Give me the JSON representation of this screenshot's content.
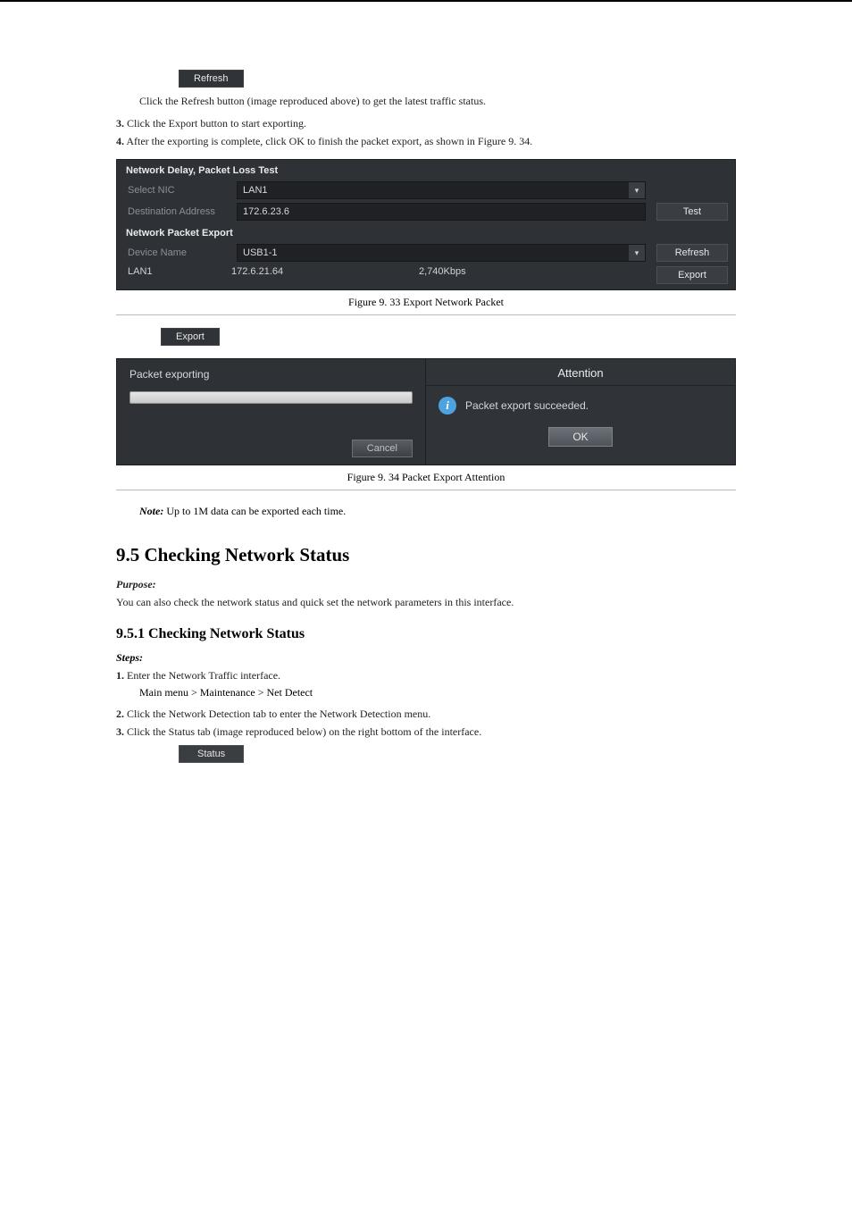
{
  "topBar": {
    "refresh_label": "Refresh"
  },
  "step2_text": "Click the Refresh button (image reproduced above) to get the latest traffic status.",
  "step3_label": "3.",
  "step3_text": "Click the Export button to start exporting.",
  "step4_label": "4.",
  "step4_text": "After the exporting is complete, click OK to finish the packet export, as shown in Figure 9. 34.",
  "panel1": {
    "section_a": "Network Delay, Packet Loss Test",
    "select_nic_label": "Select NIC",
    "select_nic_value": "LAN1",
    "dest_addr_label": "Destination Address",
    "dest_addr_value": "172.6.23.6",
    "test_btn": "Test",
    "section_b": "Network Packet Export",
    "device_name_label": "Device Name",
    "device_name_value": "USB1-1",
    "refresh_btn": "Refresh",
    "row_c1": "LAN1",
    "row_c2": "172.6.21.64",
    "row_c3": "2,740Kbps",
    "export_btn": "Export"
  },
  "caption1": "Figure 9. 33 Export Network Packet",
  "export_tab": "Export",
  "progress": {
    "title": "Packet exporting",
    "cancel": "Cancel"
  },
  "attention": {
    "title": "Attention",
    "message": "Packet export succeeded.",
    "ok": "OK"
  },
  "caption2": "Figure 9. 34  Packet Export Attention",
  "note_label": "Note:",
  "note_text": "Up to 1M data can be exported each time.",
  "h2": "9.5 Checking Network Status",
  "h2_purpose_label": "Purpose:",
  "h2_purpose_text": "You can also check the network status and quick set the network parameters in this interface.",
  "h3": "9.5.1 Checking Network Status",
  "steps_label": "Steps:",
  "step1_label": "1.",
  "step1_text": "Enter the Network Traffic interface.",
  "nav_path": "Main menu > Maintenance > Net Detect",
  "step2b_label": "2.",
  "step2b_text": "Click the Network Detection tab to enter the Network Detection menu.",
  "step3b_label": "3.",
  "step3b_text": "Click the Status tab (image reproduced below) on the right bottom of the interface.",
  "status_tab": "Status"
}
